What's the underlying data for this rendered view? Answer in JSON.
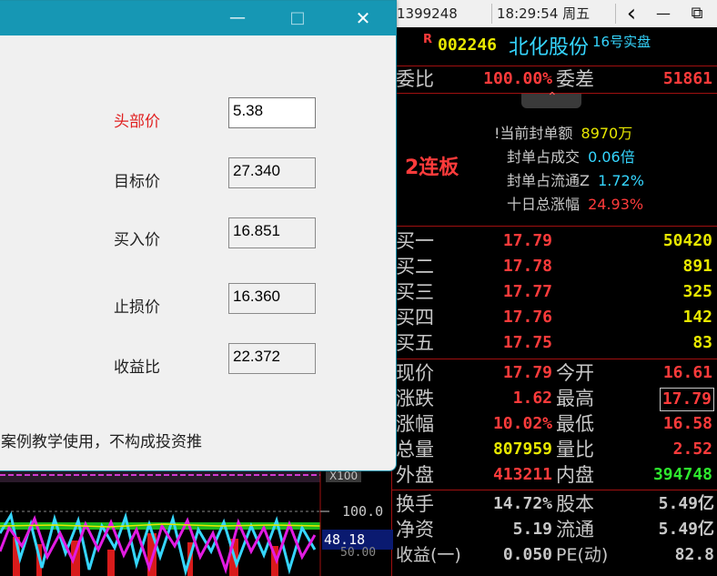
{
  "topbar": {
    "code_fragment": "1399248",
    "time": "18:29:54 周五",
    "back_glyph": "‹",
    "minimize_glyph": "—",
    "restore_glyph": "⧉"
  },
  "stock": {
    "r_tag": "R",
    "code": "002246",
    "name": "北化股份",
    "sub": "16号实盘"
  },
  "weibi": {
    "label": "委比",
    "value": "100.00%",
    "label2": "委差",
    "value2": "51861"
  },
  "board": {
    "tag": "2连板",
    "items": [
      {
        "label": "!当前封单额",
        "value": "8970万"
      },
      {
        "label": "封单占成交",
        "value": "0.06倍"
      },
      {
        "label": "封单占流通Z",
        "value": "1.72%"
      },
      {
        "label": "十日总涨幅",
        "value": "24.93%"
      }
    ]
  },
  "bids": [
    {
      "label": "买一",
      "price": "17.79",
      "vol": "50420"
    },
    {
      "label": "买二",
      "price": "17.78",
      "vol": "891"
    },
    {
      "label": "买三",
      "price": "17.77",
      "vol": "325"
    },
    {
      "label": "买四",
      "price": "17.76",
      "vol": "142"
    },
    {
      "label": "买五",
      "price": "17.75",
      "vol": "83"
    }
  ],
  "quote": [
    {
      "l1": "现价",
      "v1": "17.79",
      "l2": "今开",
      "v2": "16.61"
    },
    {
      "l1": "涨跌",
      "v1": "1.62",
      "l2": "最高",
      "v2": "17.79"
    },
    {
      "l1": "涨幅",
      "v1": "10.02%",
      "l2": "最低",
      "v2": "16.58"
    },
    {
      "l1": "总量",
      "v1": "807959",
      "l2": "量比",
      "v2": "2.52"
    },
    {
      "l1": "外盘",
      "v1": "413211",
      "l2": "内盘",
      "v2": "394748"
    }
  ],
  "fund": [
    {
      "l1": "换手",
      "v1": "14.72%",
      "l2": "股本",
      "v2": "5.49亿"
    },
    {
      "l1": "净资",
      "v1": "5.19",
      "l2": "流通",
      "v2": "5.49亿"
    },
    {
      "l1": "收益(一)",
      "v1": "0.050",
      "l2": "PE(动)",
      "v2": "82.8"
    }
  ],
  "dialog": {
    "minimize": "—",
    "maximize": "□",
    "close": "✕",
    "fields": [
      {
        "label": "头部价",
        "value": "5.38"
      },
      {
        "label": "目标价",
        "value": "27.340"
      },
      {
        "label": "买入价",
        "value": "16.851"
      },
      {
        "label": "止损价",
        "value": "16.360"
      },
      {
        "label": "收益比",
        "value": "22.372"
      }
    ],
    "disclaimer": "案例教学使用，不构成投资推"
  },
  "chart": {
    "axis_top": "X100",
    "level": "100.0",
    "current": "48.18",
    "lower": "50.00"
  },
  "colors": {
    "red": "#ff3b3b",
    "yellow": "#e8e800",
    "green": "#2ee82e",
    "cyan": "#35d6ff",
    "gray": "#c8c8c8",
    "title_bar": "#1697b4"
  }
}
